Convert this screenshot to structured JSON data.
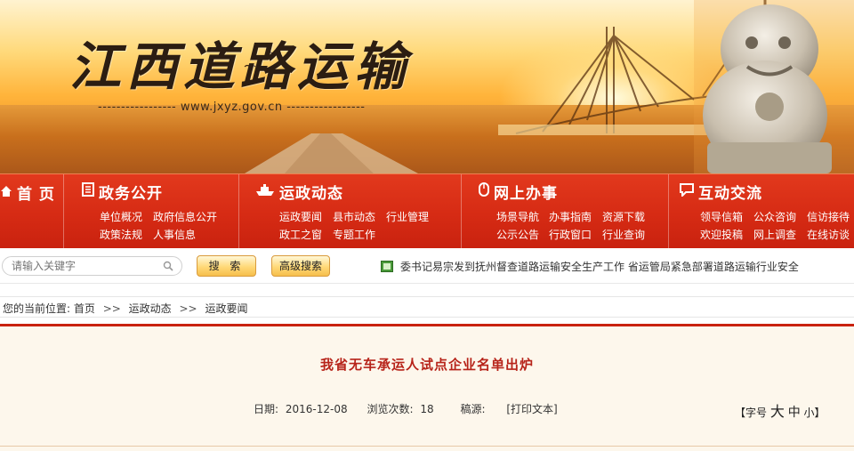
{
  "brand": {
    "title": "江西道路运输",
    "url": "----------------- www.jxyz.gov.cn -----------------"
  },
  "nav": {
    "home": "首 页",
    "sections": [
      {
        "title": "政务公开",
        "links": [
          "单位概况",
          "政府信息公开",
          "政策法规",
          "人事信息"
        ]
      },
      {
        "title": "运政动态",
        "links": [
          "运政要闻",
          "县市动态",
          "行业管理",
          "政工之窗",
          "专题工作"
        ]
      },
      {
        "title": "网上办事",
        "links": [
          "场景导航",
          "办事指南",
          "资源下载",
          "公示公告",
          "行政窗口",
          "行业查询"
        ]
      },
      {
        "title": "互动交流",
        "links": [
          "领导信箱",
          "公众咨询",
          "信访接待",
          "欢迎投稿",
          "网上调查",
          "在线访谈"
        ]
      }
    ]
  },
  "search": {
    "placeholder": "请输入关键字",
    "search_button": "搜 索",
    "advanced_button": "高级搜索"
  },
  "ticker": {
    "text": "委书记易宗发到抚州督查道路运输安全生产工作  省运管局紧急部署道路运输行业安全"
  },
  "breadcrumb": {
    "prefix": "您的当前位置:",
    "items": [
      "首页",
      "运政动态",
      "运政要闻"
    ],
    "separator": ">>"
  },
  "article": {
    "title": "我省无车承运人试点企业名单出炉",
    "date_label": "日期:",
    "date": "2016-12-08",
    "views_label": "浏览次数:",
    "views": "18",
    "source_label": "稿源:",
    "print_label": "[打印文本]",
    "fontsize": {
      "open": "【",
      "label": "字号",
      "large": "大",
      "medium": "中",
      "small": "小",
      "close": "】"
    }
  },
  "colors": {
    "nav_red": "#d62b14",
    "title_red": "#b7241a",
    "button_gold": "#ffd978",
    "article_bg": "#fdf7ec"
  }
}
